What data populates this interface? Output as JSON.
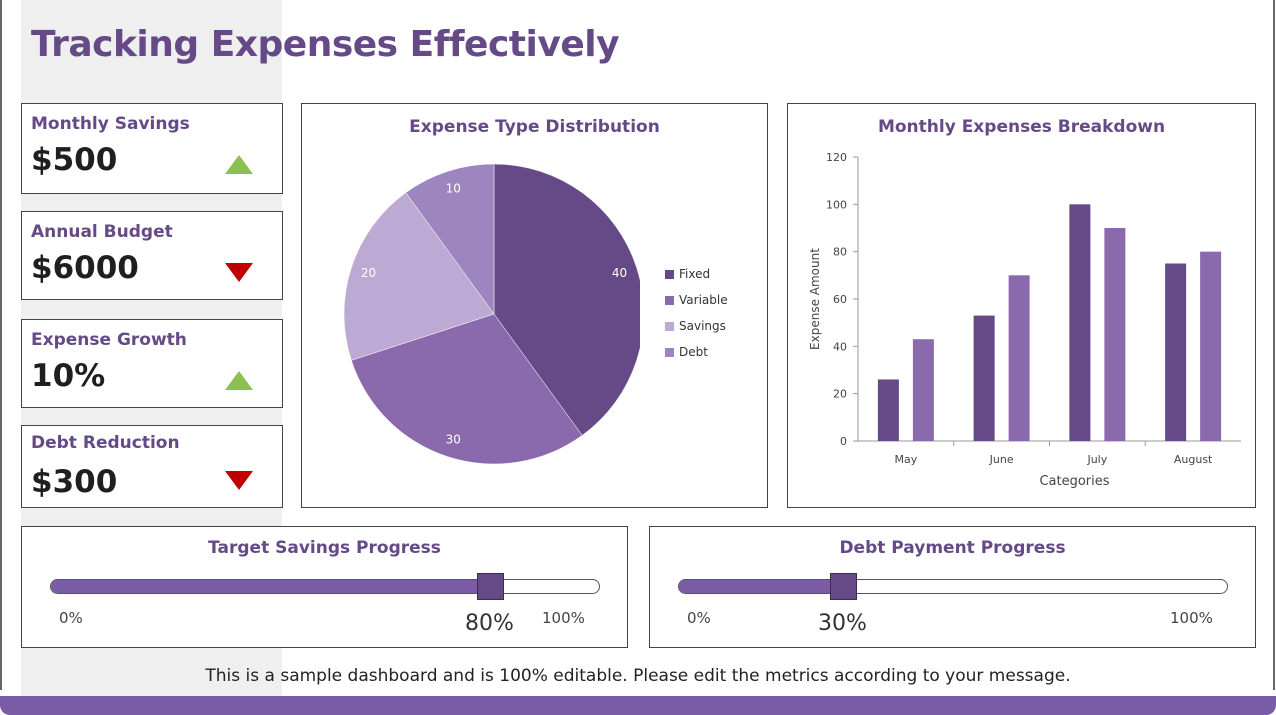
{
  "page": {
    "title": "Tracking Expenses Effectively",
    "footer": "This is a sample dashboard and is 100% editable. Please edit the metrics according to your message."
  },
  "metrics": [
    {
      "label": "Monthly Savings",
      "value": "$500",
      "trend": "up",
      "trend_icon": "up-triangle-icon"
    },
    {
      "label": "Annual Budget",
      "value": "$6000",
      "trend": "down",
      "trend_icon": "down-triangle-icon"
    },
    {
      "label": "Expense Growth",
      "value": "10%",
      "trend": "up",
      "trend_icon": "up-triangle-icon"
    },
    {
      "label": "Debt Reduction",
      "value": "$300",
      "trend": "down",
      "trend_icon": "down-triangle-icon"
    }
  ],
  "colors": {
    "accent": "#654a87",
    "up": "#8cc152",
    "down": "#c00000",
    "series1": "#654a87",
    "series2": "#8a6aac"
  },
  "pie": {
    "title": "Expense Type Distribution",
    "legend": [
      {
        "label": "Fixed",
        "value": "40",
        "color": "#654a87"
      },
      {
        "label": "Variable",
        "value": "30",
        "color": "#8a6aac"
      },
      {
        "label": "Savings",
        "value": "20",
        "color": "#bcaad4"
      },
      {
        "label": "Debt",
        "value": "10",
        "color": "#9d85c0"
      }
    ]
  },
  "bar": {
    "title": "Monthly Expenses Breakdown",
    "xlabel": "Categories",
    "ylabel": "Expense Amount"
  },
  "chart_data": [
    {
      "type": "pie",
      "title": "Expense Type Distribution",
      "categories": [
        "Fixed",
        "Variable",
        "Savings",
        "Debt"
      ],
      "values": [
        40,
        30,
        20,
        10
      ],
      "legend": "right"
    },
    {
      "type": "bar",
      "title": "Monthly Expenses Breakdown",
      "categories": [
        "May",
        "June",
        "July",
        "August"
      ],
      "series": [
        {
          "values": [
            26,
            53,
            100,
            75
          ]
        },
        {
          "values": [
            43,
            70,
            90,
            80
          ]
        }
      ],
      "xlabel": "Categories",
      "ylabel": "Expense Amount",
      "ylim": [
        0,
        120
      ],
      "yticks": [
        "0",
        "20",
        "40",
        "60",
        "80",
        "100",
        "120"
      ],
      "grid": false
    }
  ],
  "progress": [
    {
      "title": "Target Savings Progress",
      "value": 0.8,
      "value_label": "80%",
      "min_label": "0%",
      "max_label": "100%"
    },
    {
      "title": "Debt Payment Progress",
      "value": 0.3,
      "value_label": "30%",
      "min_label": "0%",
      "max_label": "100%"
    }
  ]
}
